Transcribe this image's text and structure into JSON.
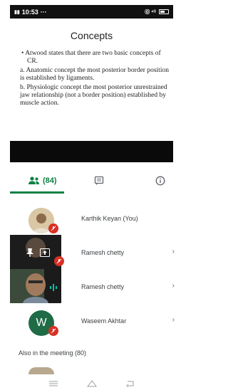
{
  "status_bar": {
    "time": "10:53",
    "dots": "···",
    "right_indicators": "Ⓞ ⁴ᴳ"
  },
  "slide": {
    "title": "Concepts",
    "bullet": "Atwood states that there are two basic concepts of CR.",
    "point_a": "a. Anatomic concept the most posterior border position is established by ligaments.",
    "point_b": "b. Physiologic concept the most posterior unrestrained jaw relationship (not a border position) established by muscle action."
  },
  "tabs": {
    "people_count": "(84)"
  },
  "participants": [
    {
      "name": "Karthik Keyan (You)"
    },
    {
      "name": "Ramesh chetty"
    },
    {
      "name": "Ramesh chetty"
    },
    {
      "name": "Waseem Akhtar",
      "initial": "W"
    }
  ],
  "also_in_meeting": "Also in the meeting (80)",
  "colors": {
    "accent_green": "#0b8043",
    "mute_red": "#d93025",
    "avatar_w_green": "#1e6b45"
  },
  "icons": {
    "people_tab": "people-icon",
    "chat_tab": "chat-icon",
    "info_tab": "info-icon",
    "muted": "mic-off-icon",
    "pin": "pin-icon",
    "present": "present-screen-icon",
    "speaking": "audio-level-icon"
  }
}
